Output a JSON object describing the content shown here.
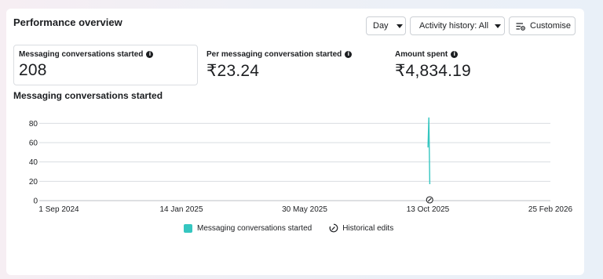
{
  "header": {
    "title": "Performance overview",
    "day_label": "Day",
    "activity_label": "Activity history: All",
    "customise_label": "Customise"
  },
  "metrics": [
    {
      "label": "Messaging conversations started",
      "value": "208"
    },
    {
      "label": "Per messaging conversation started",
      "value": "₹23.24"
    },
    {
      "label": "Amount spent",
      "value": "₹4,834.19"
    }
  ],
  "chart_title": "Messaging conversations started",
  "legend": {
    "series_label": "Messaging conversations started",
    "edits_label": "Historical edits"
  },
  "colors": {
    "series": "#35c6c0",
    "grid": "#dadde1"
  },
  "chart_data": {
    "type": "line",
    "x_tick_labels": [
      "1 Sep 2024",
      "14 Jan 2025",
      "30 May 2025",
      "13 Oct 2025",
      "25 Feb 2026"
    ],
    "y_ticks": [
      0,
      20,
      40,
      60,
      80
    ],
    "ylim": [
      0,
      90
    ],
    "series": [
      {
        "values": [
          {
            "x": "2025-10-13",
            "y": 55
          },
          {
            "x": "2025-10-14",
            "y": 86
          },
          {
            "x": "2025-10-15",
            "y": 17
          }
        ]
      }
    ],
    "historical_edit_dates": [
      "2025-10-14"
    ],
    "grid": true,
    "legend_position": "bottom"
  }
}
